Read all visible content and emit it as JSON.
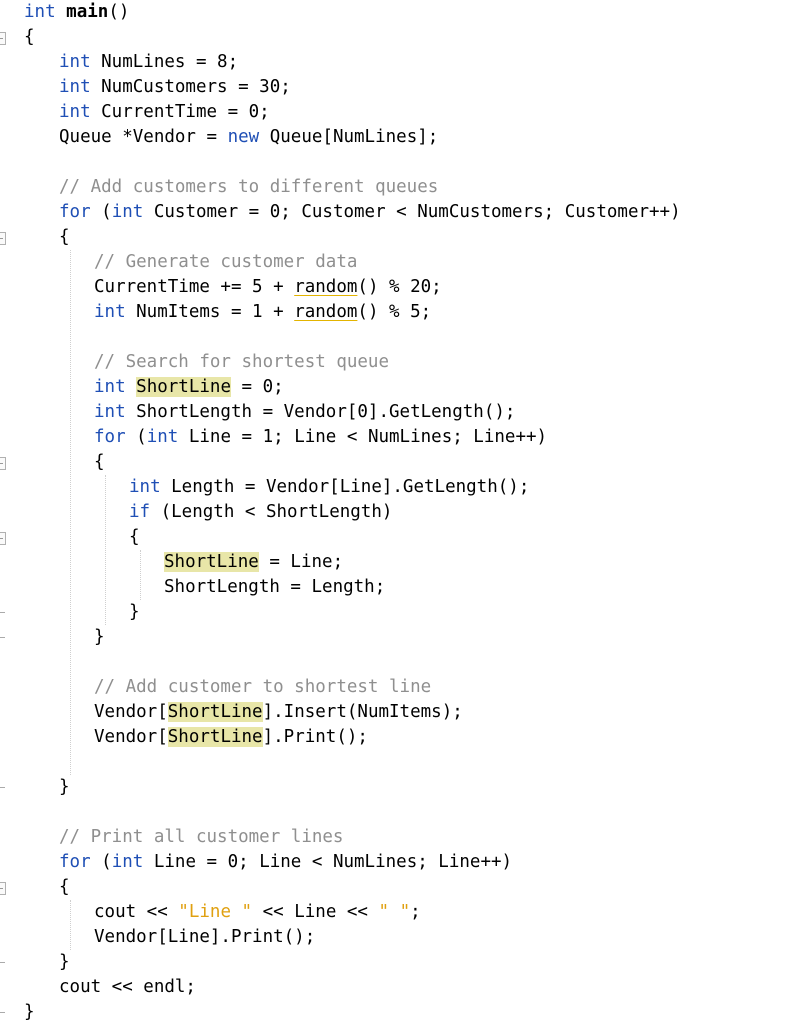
{
  "editor": {
    "language": "cpp",
    "highlighted_identifier": "ShortLine",
    "lines": [
      {
        "indent": 0,
        "fold": false,
        "end": false,
        "tokens": [
          {
            "t": "int",
            "c": "kw"
          },
          {
            "t": " "
          },
          {
            "t": "main",
            "c": "bold"
          },
          {
            "t": "()"
          }
        ]
      },
      {
        "indent": 0,
        "fold": true,
        "end": false,
        "tokens": [
          {
            "t": "{"
          }
        ]
      },
      {
        "indent": 1,
        "fold": false,
        "end": false,
        "tokens": [
          {
            "t": "int",
            "c": "kw"
          },
          {
            "t": " NumLines = 8;"
          }
        ]
      },
      {
        "indent": 1,
        "fold": false,
        "end": false,
        "tokens": [
          {
            "t": "int",
            "c": "kw"
          },
          {
            "t": " NumCustomers = 30;"
          }
        ]
      },
      {
        "indent": 1,
        "fold": false,
        "end": false,
        "tokens": [
          {
            "t": "int",
            "c": "kw"
          },
          {
            "t": " CurrentTime = 0;"
          }
        ]
      },
      {
        "indent": 1,
        "fold": false,
        "end": false,
        "tokens": [
          {
            "t": "Queue *Vendor = "
          },
          {
            "t": "new",
            "c": "kw"
          },
          {
            "t": " Queue[NumLines];"
          }
        ]
      },
      {
        "indent": 1,
        "fold": false,
        "end": false,
        "tokens": []
      },
      {
        "indent": 1,
        "fold": false,
        "end": false,
        "tokens": [
          {
            "t": "// Add customers to different queues",
            "c": "cm"
          }
        ]
      },
      {
        "indent": 1,
        "fold": false,
        "end": false,
        "tokens": [
          {
            "t": "for",
            "c": "kw"
          },
          {
            "t": " ("
          },
          {
            "t": "int",
            "c": "kw"
          },
          {
            "t": " Customer = 0; Customer < NumCustomers; Customer++)"
          }
        ]
      },
      {
        "indent": 1,
        "fold": true,
        "end": false,
        "tokens": [
          {
            "t": "{"
          }
        ]
      },
      {
        "indent": 2,
        "fold": false,
        "end": false,
        "tokens": [
          {
            "t": "// Generate customer data",
            "c": "cm"
          }
        ]
      },
      {
        "indent": 2,
        "fold": false,
        "end": false,
        "tokens": [
          {
            "t": "CurrentTime += 5 + "
          },
          {
            "t": "random",
            "c": "warn"
          },
          {
            "t": "() % 20;"
          }
        ]
      },
      {
        "indent": 2,
        "fold": false,
        "end": false,
        "tokens": [
          {
            "t": "int",
            "c": "kw"
          },
          {
            "t": " NumItems = 1 + "
          },
          {
            "t": "random",
            "c": "warn"
          },
          {
            "t": "() % 5;"
          }
        ]
      },
      {
        "indent": 2,
        "fold": false,
        "end": false,
        "tokens": []
      },
      {
        "indent": 2,
        "fold": false,
        "end": false,
        "tokens": [
          {
            "t": "// Search for shortest queue",
            "c": "cm"
          }
        ]
      },
      {
        "indent": 2,
        "fold": false,
        "end": false,
        "tokens": [
          {
            "t": "int",
            "c": "kw"
          },
          {
            "t": " "
          },
          {
            "t": "ShortLine",
            "c": "hl"
          },
          {
            "t": " = 0;"
          }
        ]
      },
      {
        "indent": 2,
        "fold": false,
        "end": false,
        "tokens": [
          {
            "t": "int",
            "c": "kw"
          },
          {
            "t": " ShortLength = Vendor[0].GetLength();"
          }
        ]
      },
      {
        "indent": 2,
        "fold": false,
        "end": false,
        "tokens": [
          {
            "t": "for",
            "c": "kw"
          },
          {
            "t": " ("
          },
          {
            "t": "int",
            "c": "kw"
          },
          {
            "t": " Line = 1; Line < NumLines; Line++)"
          }
        ]
      },
      {
        "indent": 2,
        "fold": true,
        "end": false,
        "tokens": [
          {
            "t": "{"
          }
        ]
      },
      {
        "indent": 3,
        "fold": false,
        "end": false,
        "tokens": [
          {
            "t": "int",
            "c": "kw"
          },
          {
            "t": " Length = Vendor[Line].GetLength();"
          }
        ]
      },
      {
        "indent": 3,
        "fold": false,
        "end": false,
        "tokens": [
          {
            "t": "if",
            "c": "kw"
          },
          {
            "t": " (Length < ShortLength)"
          }
        ]
      },
      {
        "indent": 3,
        "fold": true,
        "end": false,
        "tokens": [
          {
            "t": "{"
          }
        ]
      },
      {
        "indent": 4,
        "fold": false,
        "end": false,
        "tokens": [
          {
            "t": "ShortLine",
            "c": "hl"
          },
          {
            "t": " = Line;"
          }
        ]
      },
      {
        "indent": 4,
        "fold": false,
        "end": false,
        "tokens": [
          {
            "t": "ShortLength = Length;"
          }
        ]
      },
      {
        "indent": 3,
        "fold": false,
        "end": true,
        "tokens": [
          {
            "t": "}"
          }
        ]
      },
      {
        "indent": 2,
        "fold": false,
        "end": true,
        "tokens": [
          {
            "t": "}"
          }
        ]
      },
      {
        "indent": 2,
        "fold": false,
        "end": false,
        "tokens": []
      },
      {
        "indent": 2,
        "fold": false,
        "end": false,
        "tokens": [
          {
            "t": "// Add customer to shortest line",
            "c": "cm"
          }
        ]
      },
      {
        "indent": 2,
        "fold": false,
        "end": false,
        "tokens": [
          {
            "t": "Vendor["
          },
          {
            "t": "ShortLine",
            "c": "hl"
          },
          {
            "t": "].Insert(NumItems);"
          }
        ]
      },
      {
        "indent": 2,
        "fold": false,
        "end": false,
        "tokens": [
          {
            "t": "Vendor["
          },
          {
            "t": "ShortLine",
            "c": "hl"
          },
          {
            "t": "].Print();"
          }
        ]
      },
      {
        "indent": 2,
        "fold": false,
        "end": false,
        "tokens": []
      },
      {
        "indent": 1,
        "fold": false,
        "end": true,
        "tokens": [
          {
            "t": "}"
          }
        ]
      },
      {
        "indent": 1,
        "fold": false,
        "end": false,
        "tokens": []
      },
      {
        "indent": 1,
        "fold": false,
        "end": false,
        "tokens": [
          {
            "t": "// Print all customer lines",
            "c": "cm"
          }
        ]
      },
      {
        "indent": 1,
        "fold": false,
        "end": false,
        "tokens": [
          {
            "t": "for",
            "c": "kw"
          },
          {
            "t": " ("
          },
          {
            "t": "int",
            "c": "kw"
          },
          {
            "t": " Line = 0; Line < NumLines; Line++)"
          }
        ]
      },
      {
        "indent": 1,
        "fold": true,
        "end": false,
        "tokens": [
          {
            "t": "{"
          }
        ]
      },
      {
        "indent": 2,
        "fold": false,
        "end": false,
        "tokens": [
          {
            "t": "cout << "
          },
          {
            "t": "\"Line \"",
            "c": "str"
          },
          {
            "t": " << Line << "
          },
          {
            "t": "\" \"",
            "c": "str"
          },
          {
            "t": ";"
          }
        ]
      },
      {
        "indent": 2,
        "fold": false,
        "end": false,
        "tokens": [
          {
            "t": "Vendor[Line].Print();"
          }
        ]
      },
      {
        "indent": 1,
        "fold": false,
        "end": true,
        "tokens": [
          {
            "t": "}"
          }
        ]
      },
      {
        "indent": 1,
        "fold": false,
        "end": false,
        "tokens": [
          {
            "t": "cout << endl;"
          }
        ]
      },
      {
        "indent": 0,
        "fold": false,
        "end": true,
        "tokens": [
          {
            "t": "}"
          }
        ]
      }
    ]
  },
  "colors": {
    "keyword": "#1f4fb5",
    "comment": "#8f8f8f",
    "string": "#e0a010",
    "highlight": "#e8e6a8",
    "warning_underline": "#e3b400"
  }
}
